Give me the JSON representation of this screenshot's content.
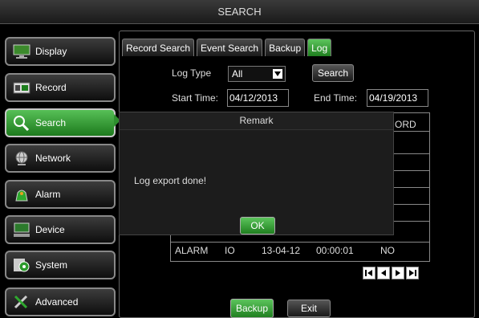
{
  "window": {
    "title": "SEARCH"
  },
  "sidebar": {
    "items": [
      {
        "label": "Display",
        "icon": "monitor-icon"
      },
      {
        "label": "Record",
        "icon": "film-icon"
      },
      {
        "label": "Search",
        "icon": "magnifier-icon",
        "active": true
      },
      {
        "label": "Network",
        "icon": "globe-icon"
      },
      {
        "label": "Alarm",
        "icon": "siren-icon"
      },
      {
        "label": "Device",
        "icon": "computer-icon"
      },
      {
        "label": "System",
        "icon": "gear-icon"
      },
      {
        "label": "Advanced",
        "icon": "tools-icon"
      }
    ]
  },
  "tabs": [
    {
      "label": "Record Search"
    },
    {
      "label": "Event Search"
    },
    {
      "label": "Backup"
    },
    {
      "label": "Log",
      "active": true
    }
  ],
  "log": {
    "type_label": "Log Type",
    "type_value": "All",
    "search_label": "Search",
    "start_label": "Start Time:",
    "start_value": "04/12/2013",
    "end_label": "End Time:",
    "end_value": "04/19/2013",
    "column_partial": "ORD"
  },
  "row": {
    "type": "ALARM",
    "event": "IO",
    "date": "13-04-12",
    "time": "00:00:01",
    "record": "NO"
  },
  "dialog": {
    "title": "Remark",
    "message": "Log export done!",
    "ok_label": "OK"
  },
  "footer": {
    "backup_label": "Backup",
    "exit_label": "Exit"
  },
  "colors": {
    "accent_green": "#2e9a2e",
    "background": "#000000"
  }
}
